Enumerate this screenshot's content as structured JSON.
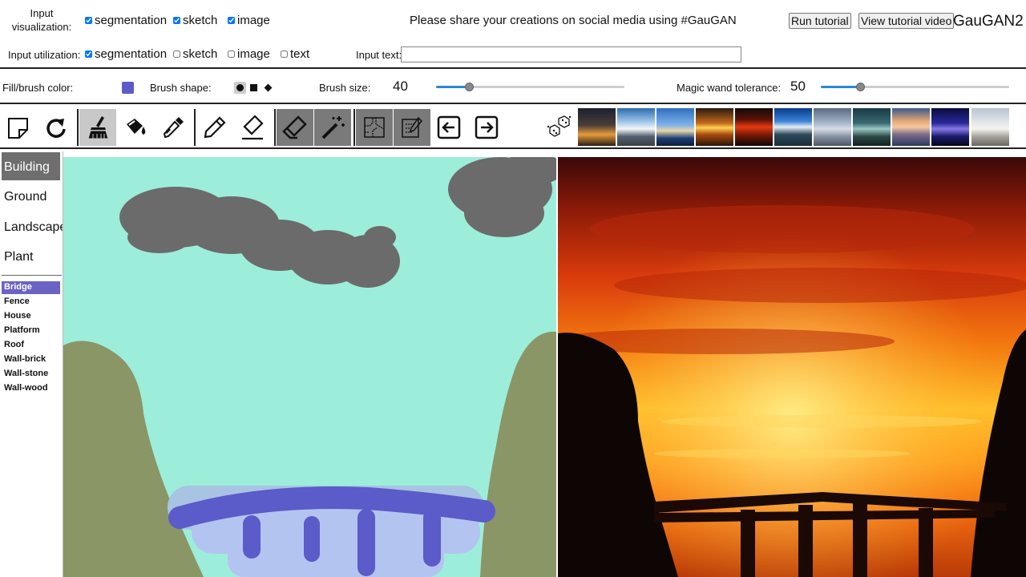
{
  "header": {
    "input_visualization_label": "Input visualization:",
    "vis_options": [
      {
        "label": "segmentation",
        "checked": true
      },
      {
        "label": "sketch",
        "checked": true
      },
      {
        "label": "image",
        "checked": true
      }
    ],
    "banner": "Please share your creations on social media using #GauGAN",
    "run_tutorial": "Run tutorial",
    "view_tutorial_video": "View tutorial video",
    "app_title": "GauGAN2"
  },
  "utilization": {
    "label": "Input utilization:",
    "options": [
      {
        "label": "segmentation",
        "checked": true
      },
      {
        "label": "sketch",
        "checked": false
      },
      {
        "label": "image",
        "checked": false
      },
      {
        "label": "text",
        "checked": false
      }
    ],
    "input_text_label": "Input text:",
    "input_text_value": ""
  },
  "brush": {
    "fill_color_label": "Fill/brush color:",
    "fill_color": "#5b5bc9",
    "brush_shape_label": "Brush shape:",
    "brush_size_label": "Brush size:",
    "brush_size_value": "40",
    "brush_size_level": 0.2,
    "wand_label": "Magic wand tolerance:",
    "wand_value": "50",
    "wand_level": 0.21
  },
  "tools": [
    "new-canvas-icon",
    "rotate-icon",
    "brush-icon",
    "paint-bucket-icon",
    "eyedropper-icon",
    "pencil-icon",
    "sketch-eraser-icon",
    "eraser-icon",
    "magic-wand-icon",
    "segmentation-map-icon",
    "sketch-map-icon",
    "arrow-left-icon",
    "arrow-right-icon",
    "dice-icon"
  ],
  "sidebar": {
    "categories": [
      "Building",
      "Ground",
      "Landscape",
      "Plant"
    ],
    "selected_category": "Building",
    "subcategories": [
      "Bridge",
      "Fence",
      "House",
      "Platform",
      "Roof",
      "Wall-brick",
      "Wall-stone",
      "Wall-wood"
    ],
    "selected_subcategory": "Bridge"
  },
  "colors": {
    "sky": "#9deddb",
    "cloud": "#6b6b6b",
    "mountain": "#8a9665",
    "water": "#a9c3e3",
    "bridge": "#5b5bc9",
    "slider_fill": "#2a88d8"
  }
}
